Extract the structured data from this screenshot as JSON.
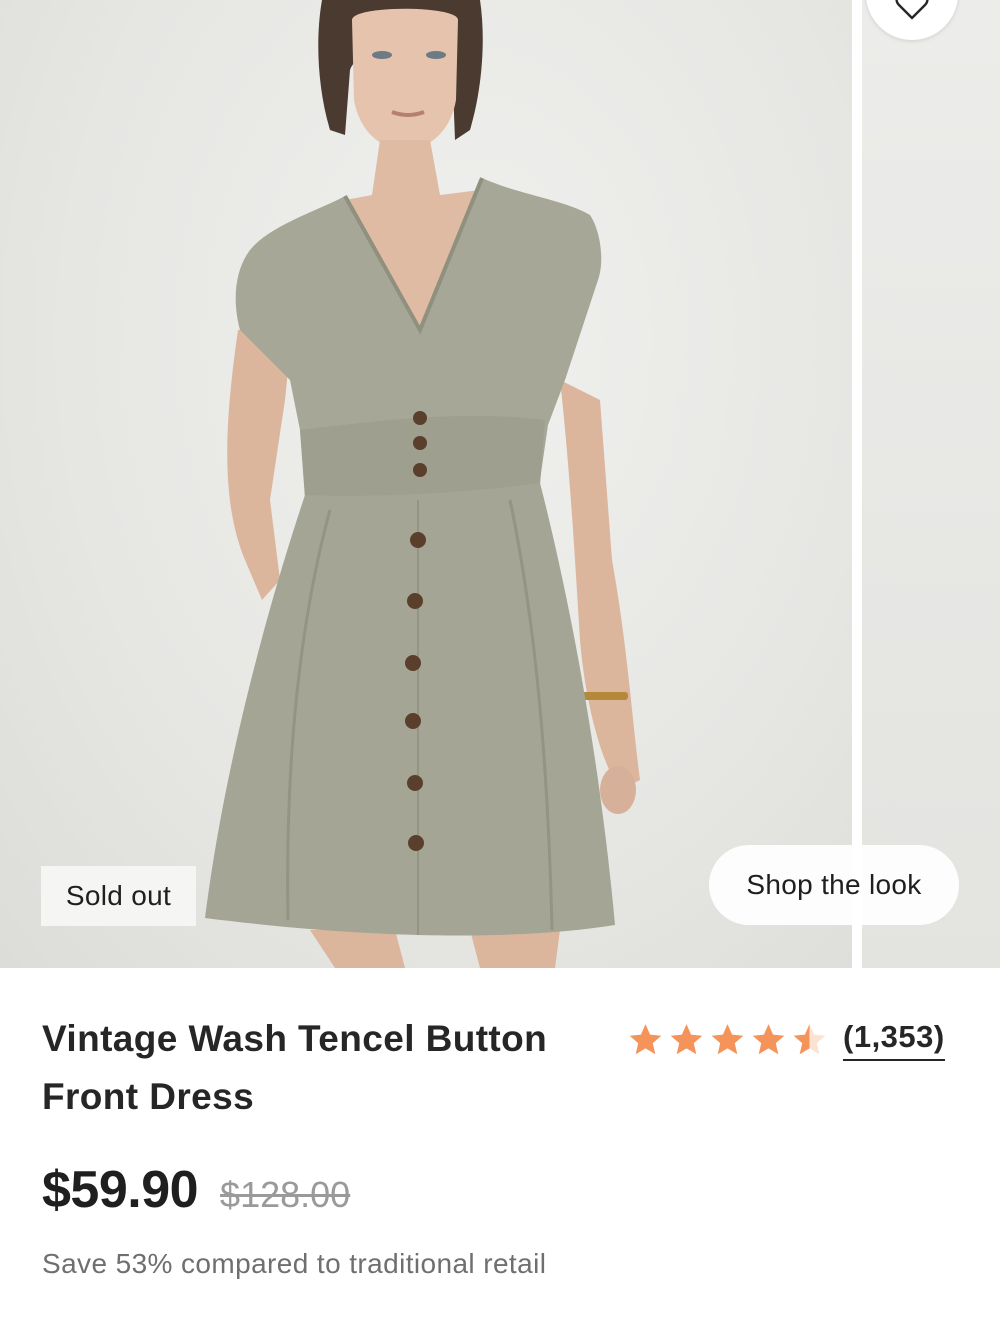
{
  "product": {
    "title": "Vintage Wash Tencel Button Front Dress",
    "badge": "Sold out",
    "shop_the_look": "Shop the look",
    "rating": {
      "stars": 4.5,
      "max_stars": 5,
      "review_count": "(1,353)"
    },
    "price": {
      "current": "$59.90",
      "original": "$128.00"
    },
    "savings_text": "Save 53% compared to traditional retail"
  },
  "icons": {
    "favorite": "heart-icon",
    "star": "star-icon"
  },
  "colors": {
    "star": "#f4945a",
    "dress": "#a6a796",
    "background": "#ffffff"
  }
}
